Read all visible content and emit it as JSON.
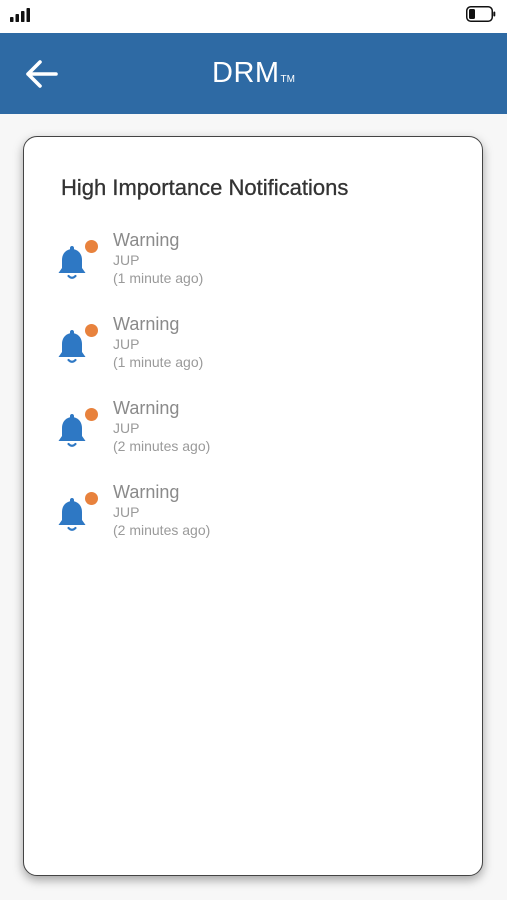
{
  "status_bar": {
    "signal_icon": "cellular-signal-icon",
    "battery_icon": "battery-icon"
  },
  "app_bar": {
    "title": "DRM",
    "trademark": "TM",
    "back_icon": "arrow-left-icon",
    "background": "#2e6aa4"
  },
  "card": {
    "title": "High Importance Notifications",
    "notifications": [
      {
        "title": "Warning",
        "source": "JUP",
        "time": "(1 minute ago)"
      },
      {
        "title": "Warning",
        "source": "JUP",
        "time": "(1 minute ago)"
      },
      {
        "title": "Warning",
        "source": "JUP",
        "time": "(2 minutes ago)"
      },
      {
        "title": "Warning",
        "source": "JUP",
        "time": "(2 minutes ago)"
      }
    ]
  },
  "colors": {
    "bell": "#2e78c4",
    "badge": "#e8823d"
  }
}
